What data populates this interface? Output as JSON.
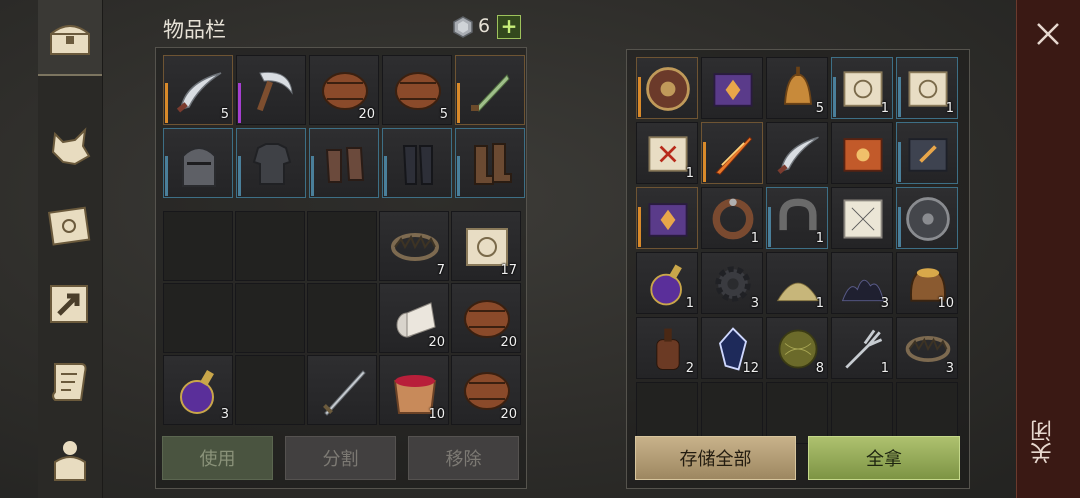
{
  "inventory": {
    "title": "物品栏",
    "gem_count": "6",
    "add_label": "+"
  },
  "equipped": [
    {
      "icon": "scimitar-icon",
      "qty": "5",
      "rarity": "orange"
    },
    {
      "icon": "sickle-icon",
      "qty": "",
      "rarity": "purple"
    },
    {
      "icon": "barrel-icon",
      "qty": "20",
      "rarity": ""
    },
    {
      "icon": "barrel-icon",
      "qty": "5",
      "rarity": ""
    },
    {
      "icon": "green-dagger-icon",
      "qty": "",
      "rarity": "orange"
    },
    {
      "icon": "great-helm-icon",
      "qty": "",
      "rarity": "blue"
    },
    {
      "icon": "chainmail-armor-icon",
      "qty": "",
      "rarity": "blue"
    },
    {
      "icon": "gauntlets-icon",
      "qty": "",
      "rarity": "blue"
    },
    {
      "icon": "greaves-icon",
      "qty": "",
      "rarity": "blue"
    },
    {
      "icon": "boots-icon",
      "qty": "",
      "rarity": "blue"
    }
  ],
  "backpack": [
    {
      "icon": "",
      "qty": ""
    },
    {
      "icon": "",
      "qty": ""
    },
    {
      "icon": "",
      "qty": ""
    },
    {
      "icon": "bear-trap-icon",
      "qty": "7"
    },
    {
      "icon": "map-scroll-icon",
      "qty": "17"
    },
    {
      "icon": "",
      "qty": ""
    },
    {
      "icon": "",
      "qty": ""
    },
    {
      "icon": "",
      "qty": ""
    },
    {
      "icon": "cloth-roll-icon",
      "qty": "20"
    },
    {
      "icon": "barrel-icon",
      "qty": "20"
    },
    {
      "icon": "purple-potion-icon",
      "qty": "3"
    },
    {
      "icon": "",
      "qty": ""
    },
    {
      "icon": "longsword-icon",
      "qty": ""
    },
    {
      "icon": "berry-bucket-icon",
      "qty": "10"
    },
    {
      "icon": "barrel-icon",
      "qty": "20"
    }
  ],
  "actions": {
    "use": "使用",
    "split": "分割",
    "remove": "移除"
  },
  "container": [
    {
      "icon": "round-shield-icon",
      "qty": "",
      "rarity": "orange"
    },
    {
      "icon": "purple-tome-icon",
      "qty": "",
      "rarity": ""
    },
    {
      "icon": "bell-icon",
      "qty": "5",
      "rarity": ""
    },
    {
      "icon": "map-scroll-icon",
      "qty": "1",
      "rarity": "blue"
    },
    {
      "icon": "map-scroll-icon",
      "qty": "1",
      "rarity": "blue"
    },
    {
      "icon": "red-rune-scroll-icon",
      "qty": "1",
      "rarity": ""
    },
    {
      "icon": "flame-sword-icon",
      "qty": "",
      "rarity": "orange"
    },
    {
      "icon": "scimitar-icon",
      "qty": "",
      "rarity": ""
    },
    {
      "icon": "orange-tome-icon",
      "qty": "",
      "rarity": ""
    },
    {
      "icon": "dark-tome-icon",
      "qty": "",
      "rarity": "blue"
    },
    {
      "icon": "purple-tome-icon",
      "qty": "",
      "rarity": "orange"
    },
    {
      "icon": "leather-collar-icon",
      "qty": "1",
      "rarity": ""
    },
    {
      "icon": "iron-shackle-icon",
      "qty": "1",
      "rarity": "blue"
    },
    {
      "icon": "sketch-paper-icon",
      "qty": "",
      "rarity": ""
    },
    {
      "icon": "iron-shield-icon",
      "qty": "",
      "rarity": "blue"
    },
    {
      "icon": "purple-potion-icon",
      "qty": "1",
      "rarity": ""
    },
    {
      "icon": "gear-icon",
      "qty": "3",
      "rarity": ""
    },
    {
      "icon": "sand-pile-icon",
      "qty": "1",
      "rarity": ""
    },
    {
      "icon": "coal-pile-icon",
      "qty": "3",
      "rarity": ""
    },
    {
      "icon": "grain-sack-icon",
      "qty": "10",
      "rarity": ""
    },
    {
      "icon": "bottle-icon",
      "qty": "2",
      "rarity": ""
    },
    {
      "icon": "crystal-icon",
      "qty": "12",
      "rarity": ""
    },
    {
      "icon": "hay-ball-icon",
      "qty": "8",
      "rarity": ""
    },
    {
      "icon": "fork-icon",
      "qty": "1",
      "rarity": ""
    },
    {
      "icon": "bear-trap-icon",
      "qty": "3",
      "rarity": ""
    },
    {
      "icon": "",
      "qty": "",
      "rarity": ""
    },
    {
      "icon": "",
      "qty": "",
      "rarity": ""
    },
    {
      "icon": "",
      "qty": "",
      "rarity": ""
    },
    {
      "icon": "",
      "qty": "",
      "rarity": ""
    },
    {
      "icon": "",
      "qty": "",
      "rarity": ""
    }
  ],
  "container_actions": {
    "store_all": "存储全部",
    "take_all": "全拿"
  },
  "close": {
    "label": "关闭"
  },
  "sidebar": [
    {
      "icon": "chest-icon"
    },
    {
      "icon": "wolf-icon"
    },
    {
      "icon": "sun-book-icon"
    },
    {
      "icon": "map-arrow-icon"
    },
    {
      "icon": "quest-scroll-icon"
    },
    {
      "icon": "character-icon"
    }
  ]
}
